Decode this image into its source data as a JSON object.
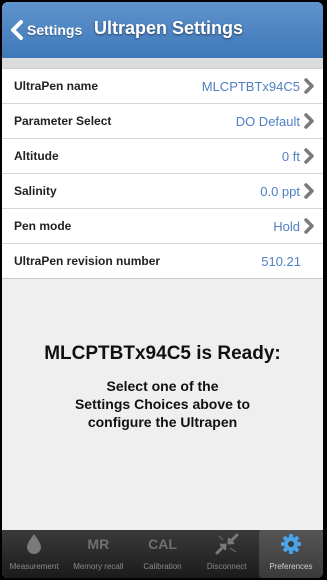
{
  "nav": {
    "back_label": "Settings",
    "title": "Ultrapen Settings"
  },
  "settings": [
    {
      "label": "UltraPen name",
      "value": "MLCPTBTx94C5",
      "chevron": true
    },
    {
      "label": "Parameter Select",
      "value": "DO Default",
      "chevron": true
    },
    {
      "label": "Altitude",
      "value": "0 ft",
      "chevron": true
    },
    {
      "label": "Salinity",
      "value": "0.0 ppt",
      "chevron": true
    },
    {
      "label": "Pen mode",
      "value": "Hold",
      "chevron": true
    },
    {
      "label": "UltraPen revision number",
      "value": "510.21",
      "chevron": false
    }
  ],
  "message": {
    "title": "MLCPTBTx94C5 is Ready:",
    "line1": "Select one of the",
    "line2": "Settings Choices above to",
    "line3": "configure the Ultrapen"
  },
  "tabs": [
    {
      "label": "Measurement",
      "icon": "water-drop-icon",
      "text": ""
    },
    {
      "label": "Memory recall",
      "icon": "mr-icon",
      "text": "MR"
    },
    {
      "label": "Calibration",
      "icon": "cal-icon",
      "text": "CAL"
    },
    {
      "label": "Disconnect",
      "icon": "disconnect-arrows-icon",
      "text": ""
    },
    {
      "label": "Preferences",
      "icon": "gear-icon",
      "text": ""
    }
  ],
  "colors": {
    "nav_blue": "#4a84c4",
    "value_blue": "#4f7fc4",
    "gear_blue": "#4aa3e6"
  }
}
